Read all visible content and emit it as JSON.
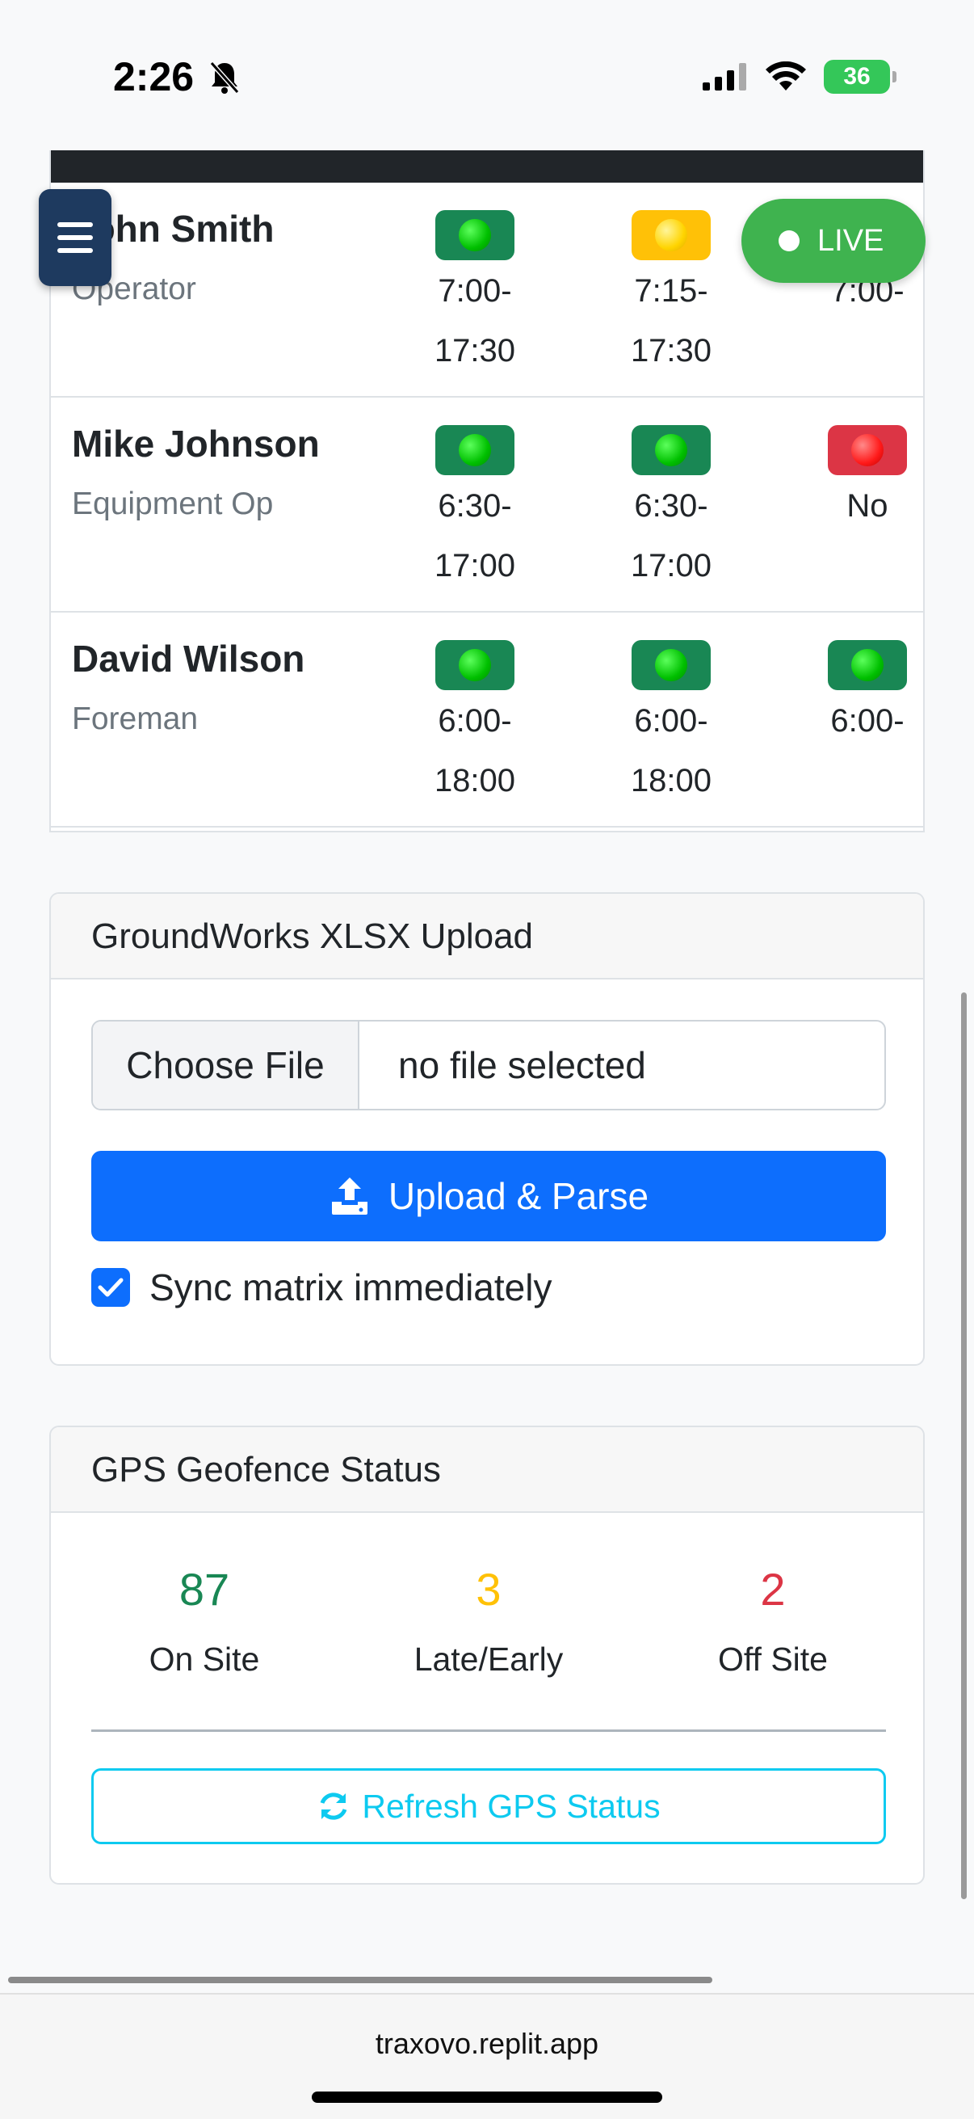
{
  "status_bar": {
    "time": "2:26",
    "battery": "36"
  },
  "employees": [
    {
      "name": "John Smith",
      "role": "Operator",
      "shifts": [
        {
          "status": "green",
          "start": "7:00-",
          "end": "17:30"
        },
        {
          "status": "yellow",
          "start": "7:15-",
          "end": "17:30"
        },
        {
          "status": "green",
          "start": "7:00-",
          "end": ""
        }
      ]
    },
    {
      "name": "Mike Johnson",
      "role": "Equipment Op",
      "shifts": [
        {
          "status": "green",
          "start": "6:30-",
          "end": "17:00"
        },
        {
          "status": "green",
          "start": "6:30-",
          "end": "17:00"
        },
        {
          "status": "red",
          "start": "No",
          "end": ""
        }
      ]
    },
    {
      "name": "David Wilson",
      "role": "Foreman",
      "shifts": [
        {
          "status": "green",
          "start": "6:00-",
          "end": "18:00"
        },
        {
          "status": "green",
          "start": "6:00-",
          "end": "18:00"
        },
        {
          "status": "green",
          "start": "6:00-",
          "end": ""
        }
      ]
    }
  ],
  "live_label": "LIVE",
  "upload_card": {
    "title": "GroundWorks XLSX Upload",
    "choose_label": "Choose File",
    "file_status": "no file selected",
    "upload_label": "Upload & Parse",
    "sync_label": "Sync matrix immediately",
    "sync_checked": true
  },
  "gps_card": {
    "title": "GPS Geofence Status",
    "stats": [
      {
        "value": "87",
        "label": "On Site",
        "color": "#198754"
      },
      {
        "value": "3",
        "label": "Late/Early",
        "color": "#ffc107"
      },
      {
        "value": "2",
        "label": "Off Site",
        "color": "#dc3545"
      }
    ],
    "refresh_label": "Refresh GPS Status"
  },
  "browser": {
    "url": "traxovo.replit.app"
  }
}
